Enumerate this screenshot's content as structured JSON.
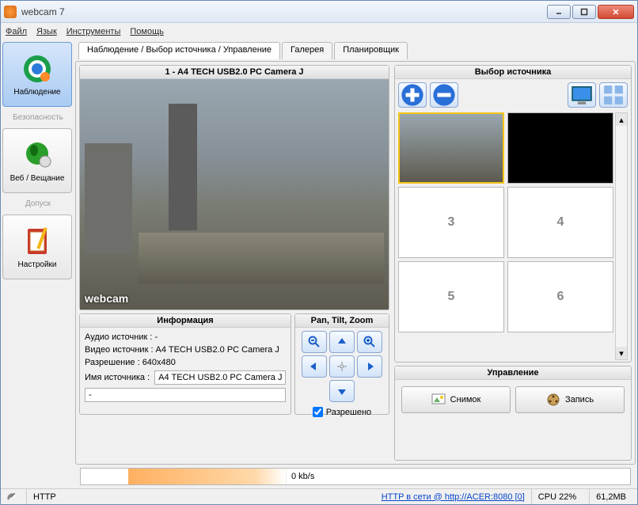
{
  "window": {
    "title": "webcam 7"
  },
  "menu": {
    "file": "Файл",
    "lang": "Язык",
    "tools": "Инструменты",
    "help": "Помощь"
  },
  "sidebar": {
    "items": [
      {
        "label": "Наблюдение"
      },
      {
        "section": "Безопасность"
      },
      {
        "label": "Веб / Вещание"
      },
      {
        "section": "Допуск"
      },
      {
        "label": "Настройки"
      }
    ]
  },
  "tabs": {
    "t0": "Наблюдение / Выбор источника / Управление",
    "t1": "Галерея",
    "t2": "Планировщик"
  },
  "video": {
    "title": "1 - A4 TECH USB2.0 PC Camera J",
    "watermark": "webcam"
  },
  "info": {
    "header": "Информация",
    "audio_label": "Аудио источник : -",
    "video_label": "Видео источник : A4 TECH USB2.0 PC Camera J",
    "res_label": "Разрешение : 640x480",
    "name_label": "Имя источника :",
    "name_value": "A4 TECH USB2.0 PC Camera J",
    "extra_value": "-"
  },
  "ptz": {
    "header": "Pan, Tilt, Zoom",
    "allow": "Разрешено"
  },
  "source": {
    "header": "Выбор источника",
    "thumbs": [
      "",
      "",
      "3",
      "4",
      "5",
      "6"
    ]
  },
  "control": {
    "header": "Управление",
    "snap": "Снимок",
    "rec": "Запись"
  },
  "bandwidth": {
    "value": "0 kb/s"
  },
  "status": {
    "http": "HTTP",
    "link": "HTTP в сети @ http://ACER:8080 [0]",
    "cpu": "CPU 22%",
    "mem": "61,2MB"
  }
}
